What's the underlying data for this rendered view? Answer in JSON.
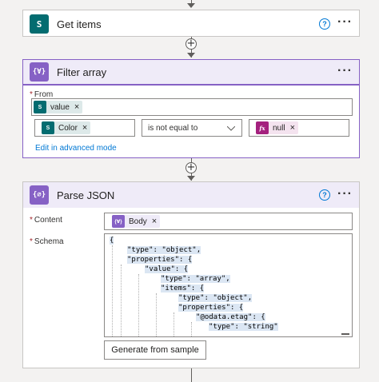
{
  "get_items": {
    "title": "Get items",
    "icon_text": "S",
    "icon_color": "#036c70"
  },
  "filter_array": {
    "title": "Filter array",
    "icon_text": "{∀}",
    "accent": "#8661c5",
    "from_label": "From",
    "from_token": "value",
    "left_token": "Color",
    "operator": "is not equal to",
    "right_token": "null",
    "right_token_icon": "fx",
    "advanced_link": "Edit in advanced mode"
  },
  "parse_json": {
    "title": "Parse JSON",
    "icon_text": "{∅}",
    "accent": "#8661c5",
    "content_label": "Content",
    "content_token": "Body",
    "schema_label": "Schema",
    "schema_lines": [
      "{",
      "\"type\": \"object\",",
      "\"properties\": {",
      "\"value\": {",
      "\"type\": \"array\",",
      "\"items\": {",
      "\"type\": \"object\",",
      "\"properties\": {",
      "\"@odata.etag\": {",
      "\"type\": \"string\""
    ],
    "generate_button": "Generate from sample"
  },
  "common": {
    "more_icon": "more-icon",
    "help_icon": "help-icon",
    "close_glyph": "×",
    "sharepoint_color": "#036c70",
    "expression_color": "#a4217e"
  }
}
